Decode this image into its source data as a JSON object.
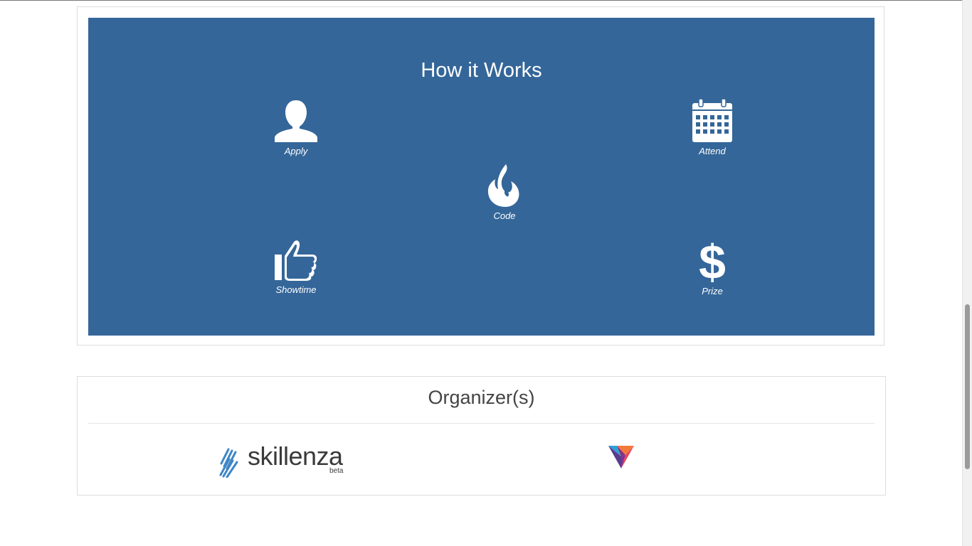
{
  "how_it_works": {
    "title": "How it Works",
    "background_color": "#346699",
    "steps": [
      {
        "label": "Apply",
        "icon": "user-icon"
      },
      {
        "label": "Attend",
        "icon": "calendar-icon"
      },
      {
        "label": "Code",
        "icon": "fire-icon"
      },
      {
        "label": "Showtime",
        "icon": "thumbs-up-icon"
      },
      {
        "label": "Prize",
        "icon": "dollar-icon"
      }
    ]
  },
  "organizers": {
    "title": "Organizer(s)",
    "logos": [
      {
        "name": "skillenza",
        "text": "skillenza",
        "subtext": "beta",
        "icon": "skillenza-logo"
      },
      {
        "name": "v-logo",
        "icon": "v-logo"
      }
    ]
  }
}
